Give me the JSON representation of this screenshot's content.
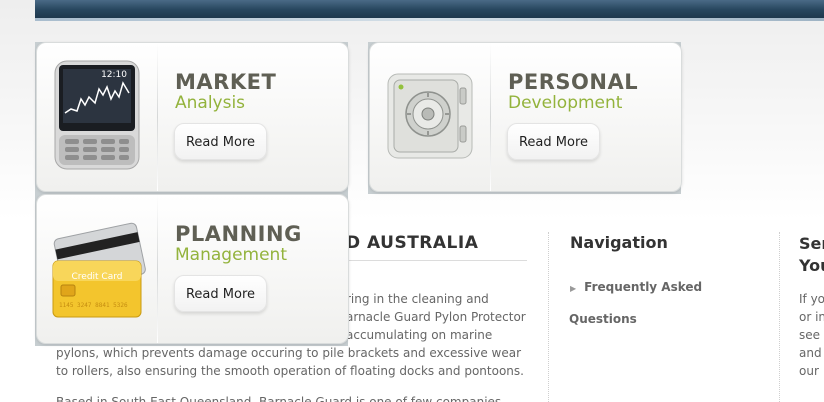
{
  "cards": [
    {
      "title": "MARKET",
      "subtitle": "Analysis",
      "button": "Read More",
      "icon": "stock-phone-icon"
    },
    {
      "title": "PERSONAL",
      "subtitle": "Development",
      "button": "Read More",
      "icon": "safe-icon"
    },
    {
      "title": "PLANNING",
      "subtitle": "Management",
      "button": "Read More",
      "icon": "credit-card-icon"
    }
  ],
  "phone_time": "12:10",
  "card_label": "Credit Card",
  "card_number": "1145 3247 8841 5326",
  "about": {
    "title": "D AUSTRALIA",
    "lines": [
      "ring in the cleaning and",
      "arnacle Guard Pylon Protector",
      "accumulating on marine",
      "pylons, which prevents damage occuring to pile brackets and excessive wear",
      "to rollers, also ensuring the smooth operation of floating docks and pontoons.",
      "Based in South East Queensland, Barnacle Guard is one of few companies"
    ]
  },
  "navigation": {
    "title": "Navigation",
    "items": [
      {
        "label": "Frequently Asked",
        "label2": "Questions"
      }
    ]
  },
  "side": {
    "title_lines": [
      "Ser",
      "You"
    ],
    "lines": [
      "If yo",
      "or in",
      "see",
      "and",
      "our"
    ]
  },
  "colors": {
    "accent": "#93b33c",
    "title": "#5f5f54"
  }
}
